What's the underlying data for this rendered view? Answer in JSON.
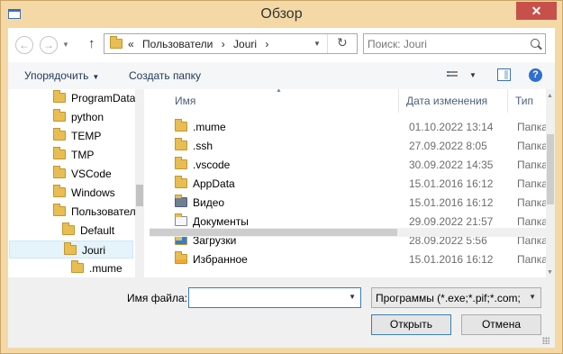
{
  "window": {
    "title": "Обзор",
    "close": "✕"
  },
  "nav": {
    "back": "←",
    "forward": "→",
    "up": "↑",
    "address": {
      "prefix": "«",
      "crumbs": [
        "Пользователи",
        "›",
        "Jouri",
        "›"
      ]
    },
    "refresh": "↻",
    "search_placeholder": "Поиск: Jouri"
  },
  "toolbar": {
    "organize_label": "Упорядочить",
    "new_folder_label": "Создать папку"
  },
  "tree": {
    "items": [
      {
        "label": "ProgramData",
        "level": 1
      },
      {
        "label": "python",
        "level": 1
      },
      {
        "label": "TEMP",
        "level": 1
      },
      {
        "label": "TMP",
        "level": 1
      },
      {
        "label": "VSCode",
        "level": 1
      },
      {
        "label": "Windows",
        "level": 1
      },
      {
        "label": "Пользователи",
        "level": 1
      },
      {
        "label": "Default",
        "level": 2
      },
      {
        "label": "Jouri",
        "level": 2,
        "selected": true
      },
      {
        "label": ".mume",
        "level": 3
      }
    ]
  },
  "list": {
    "columns": {
      "name": "Имя",
      "date": "Дата изменения",
      "type": "Тип"
    },
    "rows": [
      {
        "name": ".mume",
        "date": "01.10.2022 13:14",
        "type": "Папка",
        "icon": "folder-icon"
      },
      {
        "name": ".ssh",
        "date": "27.09.2022 8:05",
        "type": "Папка",
        "icon": "folder-icon"
      },
      {
        "name": ".vscode",
        "date": "30.09.2022 14:35",
        "type": "Папка",
        "icon": "folder-icon"
      },
      {
        "name": "AppData",
        "date": "15.01.2016 16:12",
        "type": "Папка",
        "icon": "folder-icon"
      },
      {
        "name": "Видео",
        "date": "15.01.2016 16:12",
        "type": "Папка",
        "icon": "videos-folder-icon"
      },
      {
        "name": "Документы",
        "date": "29.09.2022 21:57",
        "type": "Папка",
        "icon": "documents-folder-icon"
      },
      {
        "name": "Загрузки",
        "date": "28.09.2022 5:56",
        "type": "Папка",
        "icon": "downloads-folder-icon"
      },
      {
        "name": "Избранное",
        "date": "15.01.2016 16:12",
        "type": "Папка",
        "icon": "favorites-folder-icon"
      }
    ]
  },
  "bottom": {
    "filename_label": "Имя файла:",
    "filename_value": "",
    "filter_value": "Программы (*.exe;*.pif;*.com;",
    "open_label": "Открыть",
    "cancel_label": "Отмена"
  }
}
